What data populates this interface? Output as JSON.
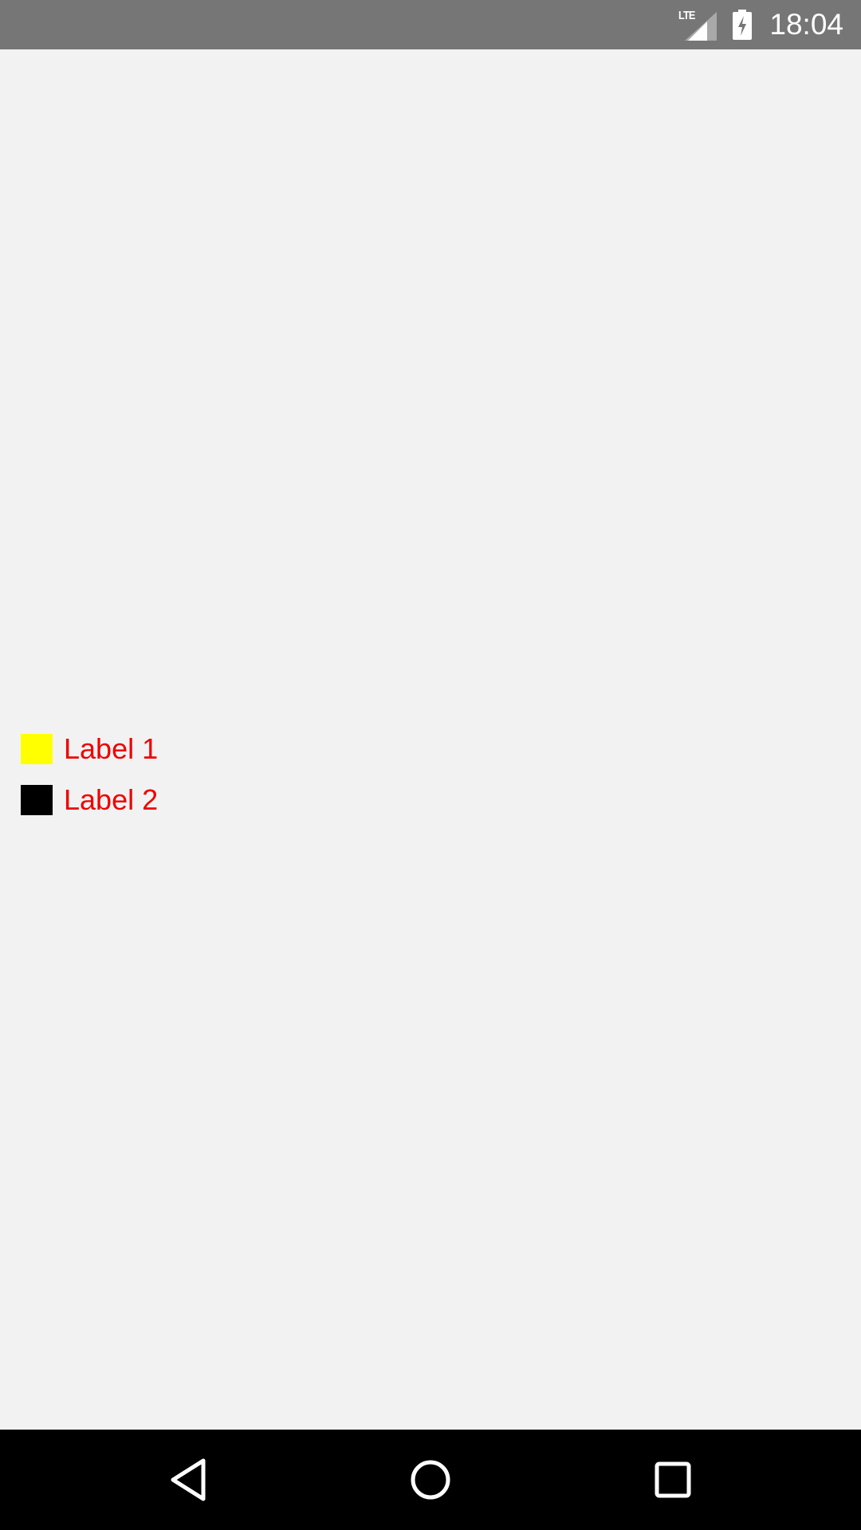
{
  "status_bar": {
    "network_label": "LTE",
    "time": "18:04",
    "background": "#767676",
    "icons": [
      "lte-signal-icon",
      "battery-charging-icon"
    ]
  },
  "content": {
    "background": "#f2f2f2",
    "legend": {
      "text_color": "#ee0000",
      "items": [
        {
          "label": "Label 1",
          "color": "#ffff00"
        },
        {
          "label": "Label 2",
          "color": "#000000"
        }
      ]
    }
  },
  "nav_bar": {
    "background": "#000000",
    "buttons": [
      "back-icon",
      "home-icon",
      "recents-icon"
    ]
  }
}
